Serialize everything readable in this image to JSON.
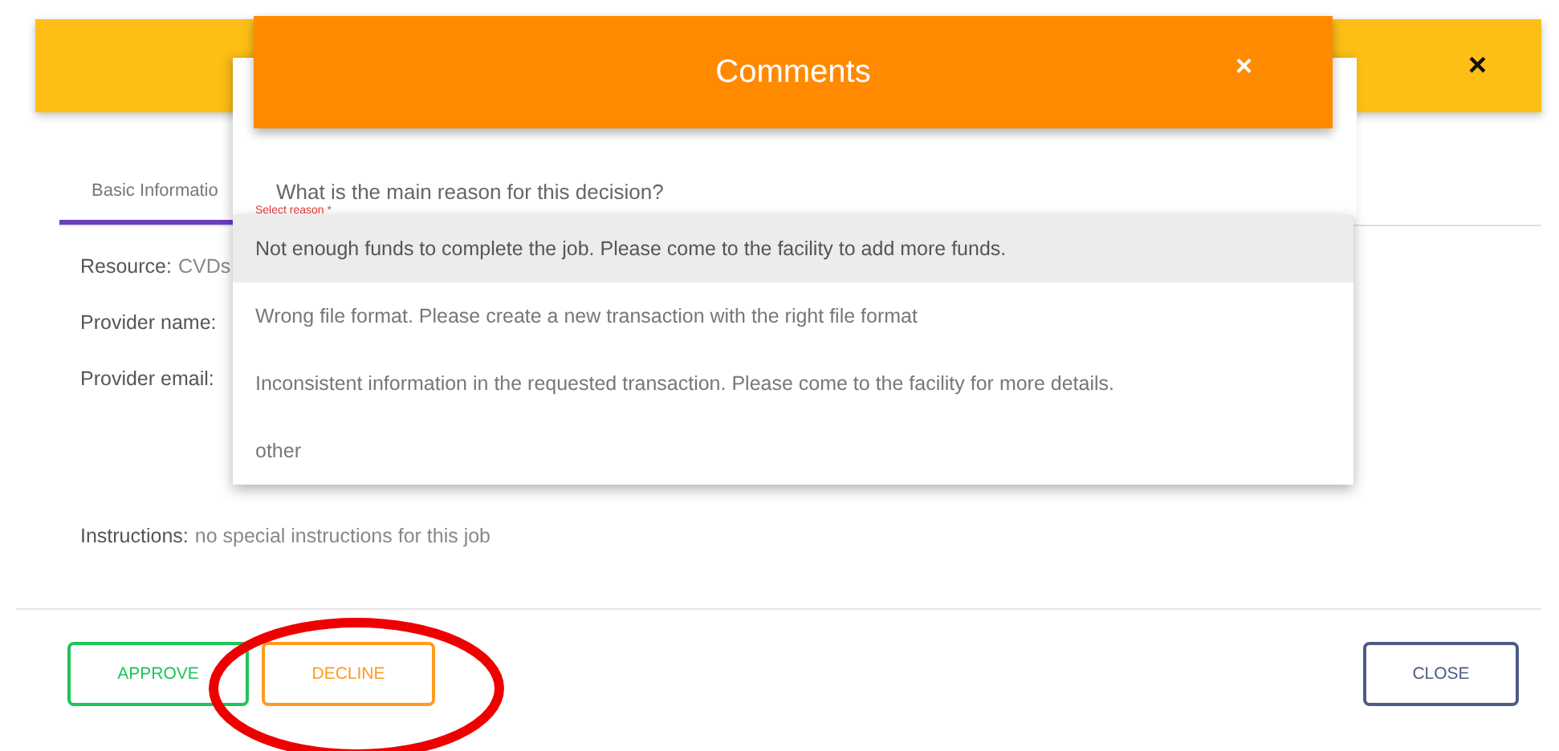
{
  "modal": {
    "close_icon": "×",
    "tabs": [
      {
        "label": "Basic Informatio",
        "selected": true
      }
    ],
    "fields": [
      {
        "label": "Resource:",
        "value": "CVDs"
      },
      {
        "label": "Provider name:"
      },
      {
        "label": "Provider email:"
      }
    ],
    "instructions": {
      "label": "Instructions:",
      "value": "no special instructions for this job"
    },
    "buttons": [
      {
        "label": "APPROVE",
        "kind": "approve"
      },
      {
        "label": "DECLINE",
        "kind": "decline"
      },
      {
        "label": "CLOSE",
        "kind": "close"
      }
    ]
  },
  "comments_dialog": {
    "title": "Comments",
    "close_icon": "×",
    "question": "What is the main reason for this decision?",
    "field_label": "Select reason *",
    "options": [
      {
        "label": "Not enough funds to complete the job. Please come to the facility to add more funds.",
        "highlighted": true
      },
      {
        "label": "Wrong file format. Please create a new transaction with the right file format",
        "highlighted": false
      },
      {
        "label": "Inconsistent information in the requested transaction. Please come to the facility for more details.",
        "highlighted": false
      },
      {
        "label": "other",
        "highlighted": false
      }
    ]
  }
}
